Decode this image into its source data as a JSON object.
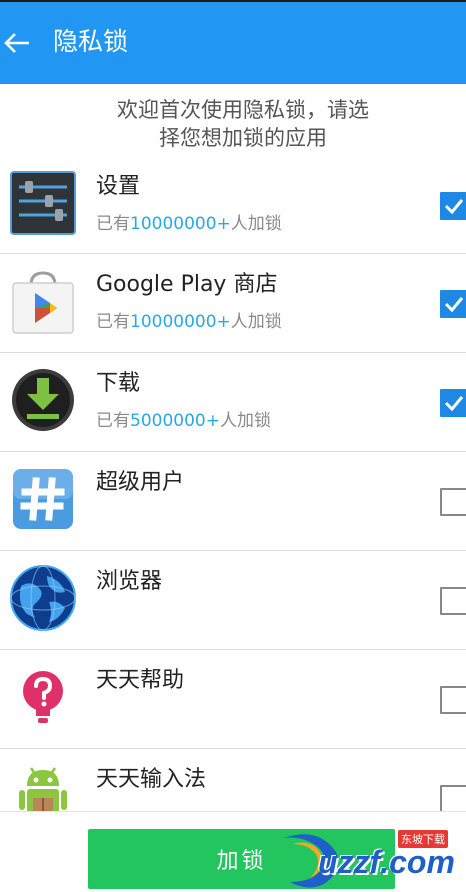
{
  "app_bar": {
    "title": "隐私锁"
  },
  "intro": {
    "line1": "欢迎首次使用隐私锁，请选",
    "line2": "择您想加锁的应用"
  },
  "apps": [
    {
      "name": "设置",
      "prefix": "已有",
      "count": "10000000+",
      "suffix": "人加锁",
      "checked": true,
      "icon": "settings-icon"
    },
    {
      "name": "Google Play 商店",
      "prefix": "已有",
      "count": "10000000+",
      "suffix": "人加锁",
      "checked": true,
      "icon": "play-store-icon"
    },
    {
      "name": "下载",
      "prefix": "已有",
      "count": "5000000+",
      "suffix": "人加锁",
      "checked": true,
      "icon": "download-icon"
    },
    {
      "name": "超级用户",
      "checked": false,
      "icon": "superuser-hash-icon"
    },
    {
      "name": "浏览器",
      "checked": false,
      "icon": "browser-globe-icon"
    },
    {
      "name": "天天帮助",
      "checked": false,
      "icon": "help-bulb-icon"
    },
    {
      "name": "天天输入法",
      "checked": false,
      "icon": "android-input-icon"
    }
  ],
  "bottom": {
    "lock_button": "加锁"
  },
  "watermark": {
    "brand": "uzzf.com",
    "tag": "东坡下载"
  },
  "colors": {
    "app_bar": "#2196f3",
    "accent_number": "#29a9e1",
    "checkbox_on": "#1e88e5",
    "lock_button": "#22c55e"
  }
}
